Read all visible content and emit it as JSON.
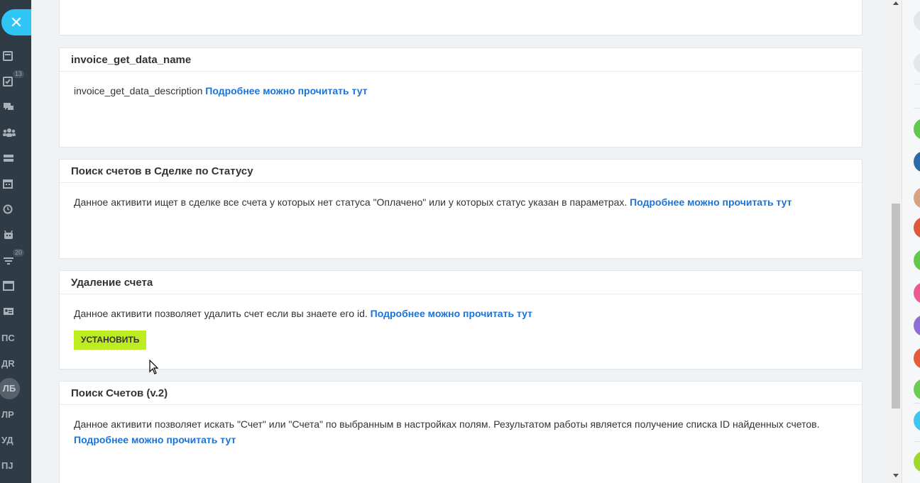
{
  "left_rail": {
    "close_icon": "close-icon",
    "badges": {
      "tasks": "13",
      "filter": "20"
    },
    "initials": [
      "ПС",
      "ДR",
      "ЛБ",
      "ЛР",
      "УД",
      "ПJ"
    ]
  },
  "cards": [
    {
      "title": "",
      "description": "",
      "link": ""
    },
    {
      "title": "invoice_get_data_name",
      "description": "invoice_get_data_description",
      "link": "Подробнее можно прочитать тут"
    },
    {
      "title": "Поиск счетов в Сделке по Статусу",
      "description": "Данное активити ищет в сделке все счета у которых нет статуса \"Оплачено\" или у которых статус указан в параметрах.",
      "link": "Подробнее можно прочитать тут"
    },
    {
      "title": "Удаление счета",
      "description": "Данное активити позволяет удалить счет если вы знаете его id.",
      "link": "Подробнее можно прочитать тут",
      "button": "УСТАНОВИТЬ"
    },
    {
      "title": "Поиск Счетов (v.2)",
      "description": "Данное активити позволяет искать \"Счет\" или \"Счета\" по выбранным в настройках полям. Результатом работы является получение списка ID найденных счетов.",
      "link": "Подробнее можно прочитать тут"
    }
  ],
  "colors": {
    "accent": "#2fc6f6",
    "link": "#1a73d9",
    "install_button": "#bbed21",
    "left_rail_bg": "#2f3b45"
  }
}
